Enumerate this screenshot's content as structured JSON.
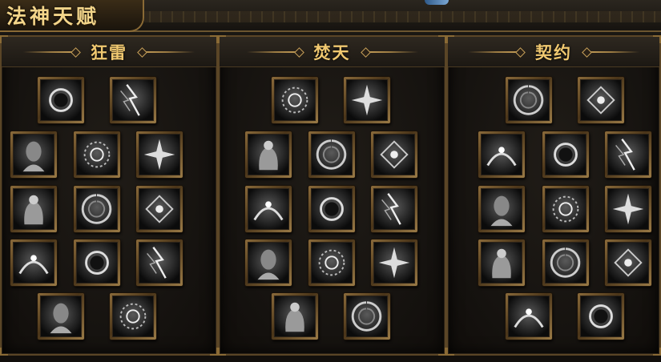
{
  "window": {
    "title": "法神天赋"
  },
  "colors": {
    "gold": "#f0c870",
    "frame": "#8a6a35",
    "background": "#15120f"
  },
  "trees": [
    {
      "name": "狂雷",
      "skills": [
        {
          "icon": "praying-hands-orb-icon"
        },
        {
          "icon": "lightning-hand-icon"
        },
        {
          "icon": "dark-eclipse-ring-icon"
        },
        {
          "icon": "lightning-storm-icon"
        },
        {
          "icon": "mage-portrait-icon"
        },
        {
          "icon": "glowing-staff-icon"
        },
        {
          "icon": "rune-circle-icon"
        },
        {
          "icon": "bearded-sage-icon"
        },
        {
          "icon": "spinning-rune-wheel-icon"
        },
        {
          "icon": "light-burst-icon"
        },
        {
          "icon": "rune-wheel-icon"
        },
        {
          "icon": "knot-sigil-icon"
        },
        {
          "icon": "ornate-seal-icon"
        }
      ]
    },
    {
      "name": "焚天",
      "skills": [
        {
          "icon": "crystal-shard-icon"
        },
        {
          "icon": "robed-wizard-icon"
        },
        {
          "icon": "casting-mage-icon"
        },
        {
          "icon": "hooded-monk-icon"
        },
        {
          "icon": "swirl-vortex-icon"
        },
        {
          "icon": "orb-ring-icon"
        },
        {
          "icon": "hamsa-hand-icon"
        },
        {
          "icon": "arcane-disc-icon"
        },
        {
          "icon": "open-hands-icon"
        },
        {
          "icon": "cupped-hands-icon"
        },
        {
          "icon": "light-figure-icon"
        },
        {
          "icon": "reaching-hand-icon"
        },
        {
          "icon": "radiant-orb-icon"
        }
      ]
    },
    {
      "name": "契约",
      "skills": [
        {
          "icon": "beam-strike-icon"
        },
        {
          "icon": "spirit-form-icon"
        },
        {
          "icon": "mist-cloud-icon"
        },
        {
          "icon": "lightning-arm-icon"
        },
        {
          "icon": "storm-figure-icon"
        },
        {
          "icon": "chain-lightning-icon"
        },
        {
          "icon": "energy-sphere-icon"
        },
        {
          "icon": "triangle-rune-icon"
        },
        {
          "icon": "thunderbolt-icon"
        },
        {
          "icon": "blazing-strike-icon"
        },
        {
          "icon": "fire-spirit-icon"
        },
        {
          "icon": "smoke-figure-icon"
        },
        {
          "icon": "winged-seal-icon"
        }
      ]
    }
  ]
}
